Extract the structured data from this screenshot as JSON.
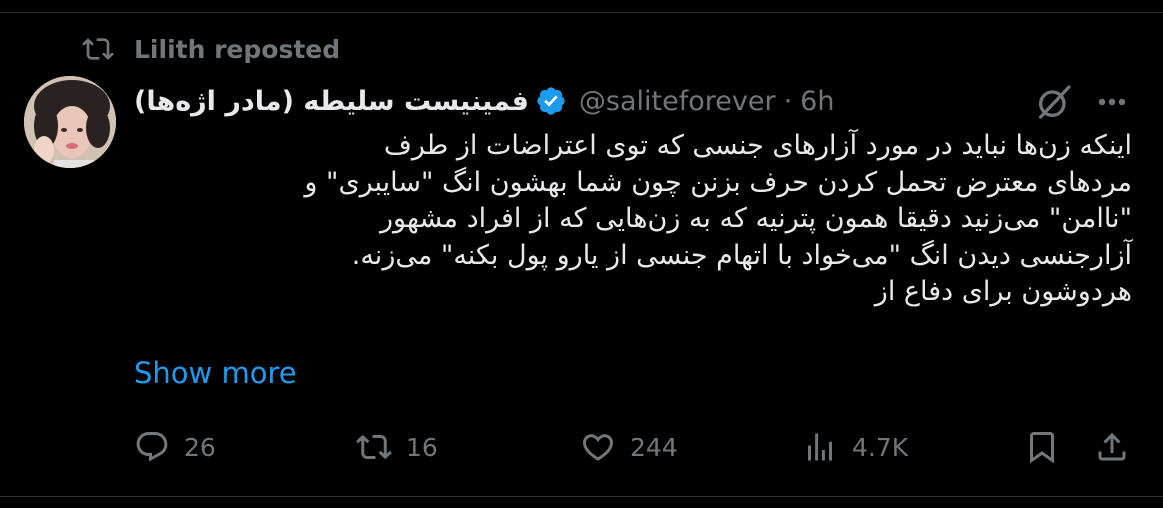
{
  "repost": {
    "label": "Lilith reposted"
  },
  "author": {
    "name": "فمینیست سلیطه (مادر اژه‌ها)",
    "handle": "@saliteforever",
    "separator": "·",
    "time": "6h"
  },
  "tweet": {
    "lines": [
      "اینکه زن‌ها نباید در مورد آزارهای جنسی که توی اعتراضات از طرف",
      "مردهای معترض تحمل کردن حرف بزنن چون شما بهشون انگ \"سایبری\" و",
      "\"ناامن\" می‌زنید دقیقا همون پترنیه که به زن‌هایی که از افراد مشهور",
      "آزارجنسی دیدن انگ \"می‌خواد با اتهام جنسی از یارو پول بکنه\" می‌زنه.",
      "هردوشون برای دفاع از"
    ],
    "show_more": "Show more"
  },
  "actions": {
    "replies": "26",
    "reposts": "16",
    "likes": "244",
    "views": "4.7K"
  },
  "colors": {
    "background": "#000000",
    "text": "#e7e9ea",
    "muted": "#71767b",
    "accent": "#1d9bf0"
  },
  "icons": [
    "repost-icon",
    "verified-badge-icon",
    "grok-icon",
    "more-icon",
    "reply-icon",
    "retweet-icon",
    "like-icon",
    "views-icon",
    "bookmark-icon",
    "share-icon"
  ]
}
